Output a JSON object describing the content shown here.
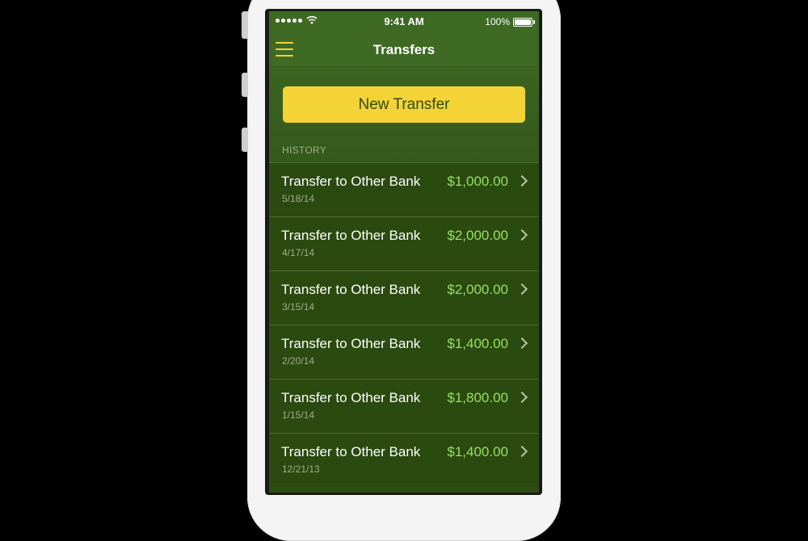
{
  "status_bar": {
    "time": "9:41 AM",
    "battery": "100%"
  },
  "navbar": {
    "title": "Transfers"
  },
  "actions": {
    "new_transfer_label": "New Transfer"
  },
  "history": {
    "label": "HISTORY",
    "items": [
      {
        "title": "Transfer to Other Bank",
        "date": "5/18/14",
        "amount": "$1,000.00"
      },
      {
        "title": "Transfer to Other Bank",
        "date": "4/17/14",
        "amount": "$2,000.00"
      },
      {
        "title": "Transfer to Other Bank",
        "date": "3/15/14",
        "amount": "$2,000.00"
      },
      {
        "title": "Transfer to Other Bank",
        "date": "2/20/14",
        "amount": "$1,400.00"
      },
      {
        "title": "Transfer to Other Bank",
        "date": "1/15/14",
        "amount": "$1,800.00"
      },
      {
        "title": "Transfer to Other Bank",
        "date": "12/21/13",
        "amount": "$1,400.00"
      }
    ]
  },
  "colors": {
    "nav_bg": "#3e6a24",
    "list_bg": "#2b4a10",
    "accent_button": "#f4d337",
    "amount_text": "#97e065"
  }
}
